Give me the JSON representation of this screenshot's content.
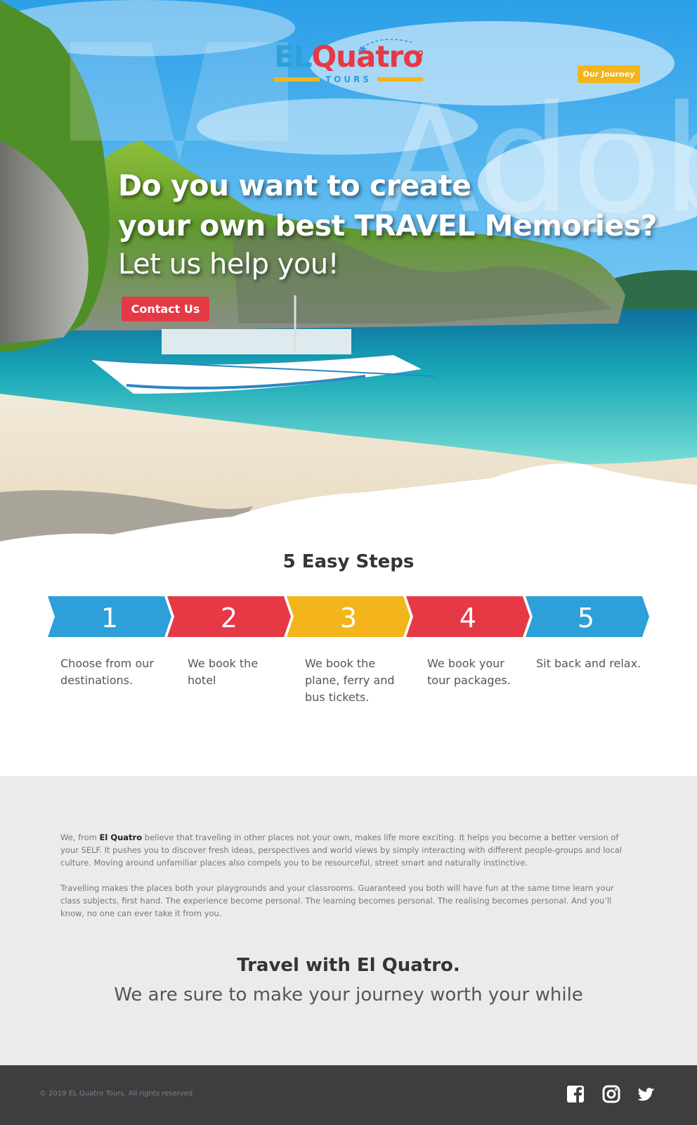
{
  "brand": {
    "logo_el": "EL",
    "logo_quatro": "Quatro",
    "logo_tours": "TOURS"
  },
  "header": {
    "journey_button": "Our Journey"
  },
  "hero": {
    "line1": "Do you want to create",
    "line2": "your own best TRAVEL Memories?",
    "line3": "Let us help you!",
    "contact_button": "Contact Us",
    "watermark": "Adob"
  },
  "steps": {
    "title": "5 Easy Steps",
    "items": [
      {
        "number": "1",
        "color": "#2d9fd9",
        "desc_line1": "Choose from our",
        "desc_line2": "destinations.",
        "desc_line3": ""
      },
      {
        "number": "2",
        "color": "#e63946",
        "desc_line1": "We book the",
        "desc_line2": "hotel",
        "desc_line3": ""
      },
      {
        "number": "3",
        "color": "#f3b51b",
        "desc_line1": "We book the",
        "desc_line2": "plane, ferry and",
        "desc_line3": "bus tickets."
      },
      {
        "number": "4",
        "color": "#e63946",
        "desc_line1": "We book your",
        "desc_line2": "tour packages.",
        "desc_line3": ""
      },
      {
        "number": "5",
        "color": "#2d9fd9",
        "desc_line1": "Sit back and relax.",
        "desc_line2": "",
        "desc_line3": ""
      }
    ]
  },
  "about": {
    "p1_prefix": "We, from ",
    "p1_brand": "El Quatro",
    "p1_rest": " believe that traveling in other places not your own, makes life more exciting. It helps you become a better version of your SELF. It pushes you to discover fresh ideas, perspectives and world views by simply interacting with different people-groups and local culture. Moving around unfamiliar places also compels you to be resourceful, street smart and naturally instinctive.",
    "p2": "Travelling makes the places both your playgrounds and your classrooms. Guaranteed you both will have fun at the same time learn your class subjects, first hand. The experience become personal. The learning becomes personal. The realising becomes personal. And you’ll know, no one can ever take it from you.",
    "tagline_title": "Travel with El Quatro.",
    "tagline_sub": "We are sure to make your journey worth your while"
  },
  "footer": {
    "copyright": "© 2019 EL Quatro Tours. All rights reserved",
    "social": [
      "facebook-icon",
      "instagram-icon",
      "twitter-icon"
    ]
  },
  "colors": {
    "blue": "#2d9fd9",
    "red": "#e63946",
    "yellow": "#f3b51b",
    "footer_bg": "#3e3e41",
    "about_bg": "#ebebeb"
  }
}
